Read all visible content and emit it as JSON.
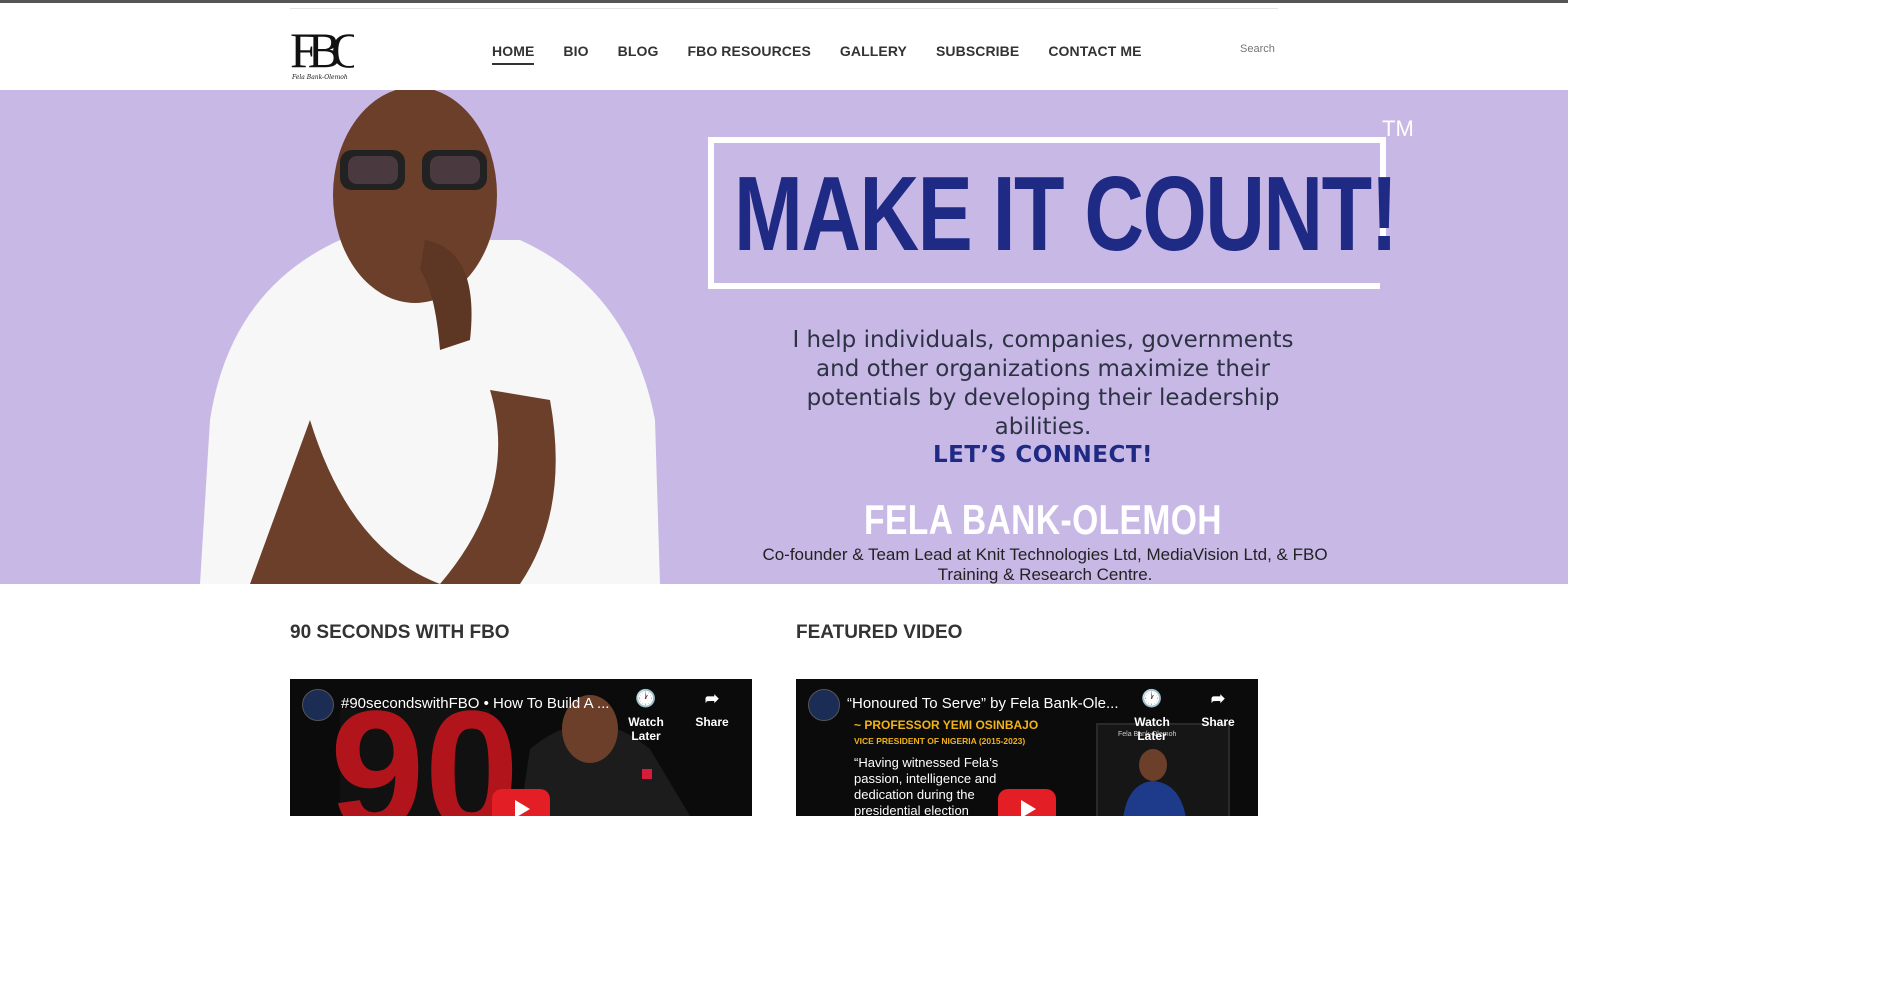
{
  "header": {
    "logo_text": "FBO",
    "logo_signature": "Fela Bank-Olemoh",
    "nav": [
      {
        "label": "HOME",
        "active": true
      },
      {
        "label": "BIO",
        "active": false
      },
      {
        "label": "BLOG",
        "active": false
      },
      {
        "label": "FBO RESOURCES",
        "active": false
      },
      {
        "label": "GALLERY",
        "active": false
      },
      {
        "label": "SUBSCRIBE",
        "active": false
      },
      {
        "label": "CONTACT ME",
        "active": false
      }
    ],
    "search_placeholder": "Search"
  },
  "hero": {
    "headline": "MAKE IT COUNT!",
    "trademark": "TM",
    "tagline": "I help individuals, companies, governments and other organizations maximize their potentials by developing their leadership abilities.",
    "cta": "LET’S CONNECT!",
    "name": "FELA BANK-OLEMOH",
    "role": "Co-founder & Team Lead at Knit Technologies Ltd, MediaVision Ltd, & FBO Training & Research Centre.",
    "background_color": "#c8b8e6",
    "headline_color": "#1f2a85"
  },
  "sections": {
    "left_title": "90 SECONDS WITH FBO",
    "right_title": "FEATURED VIDEO"
  },
  "videos": [
    {
      "title": "#90secondswithFBO • How To Build A ...",
      "watch_later": "Watch Later",
      "share": "Share",
      "overlay_quote": []
    },
    {
      "title": "“Honoured To Serve” by Fela Bank-Ole...",
      "watch_later": "Watch Later",
      "share": "Share",
      "overlay_quote": [
        "~ PROFESSOR YEMI OSINBAJO",
        "VICE PRESIDENT OF NIGERIA (2015-2023)",
        "“Having witnessed Fela’s",
        "passion, intelligence and",
        "dedication during the",
        "presidential election"
      ],
      "book_author": "Fela Bank-Olemoh"
    }
  ]
}
